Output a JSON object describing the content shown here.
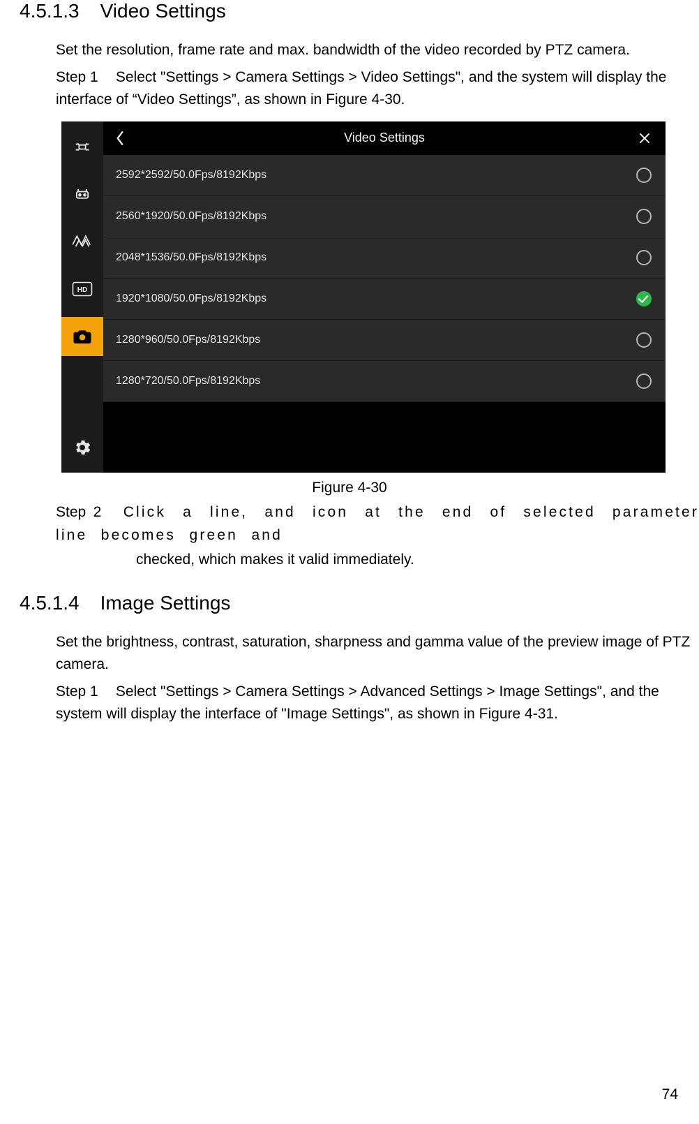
{
  "section1": {
    "number": "4.5.1.3",
    "title": "Video Settings",
    "intro": "Set the resolution, frame rate and max. bandwidth of the video recorded by PTZ camera.",
    "step1_label": "Step 1",
    "step1_text": "Select \"Settings > Camera Settings > Video Settings\", and the system will display the interface of “Video Settings”, as shown in Figure 4-30.",
    "figure_caption": "Figure 4-30",
    "step2_label": "Step 2",
    "step2_line1": "Click a line, and icon at the end of selected parameter line becomes green and",
    "step2_line2": "checked, which makes it valid immediately."
  },
  "section2": {
    "number": "4.5.1.4",
    "title": "Image Settings",
    "intro": "Set the brightness, contrast, saturation, sharpness and gamma value of the preview image of PTZ camera.",
    "step1_label": "Step 1",
    "step1_text": "Select \"Settings > Camera Settings > Advanced Settings > Image Settings\", and the system will display the interface of \"Image Settings\", as shown in Figure 4-31."
  },
  "screenshot": {
    "title": "Video Settings",
    "options": [
      {
        "label": "2592*2592/50.0Fps/8192Kbps",
        "selected": false
      },
      {
        "label": "2560*1920/50.0Fps/8192Kbps",
        "selected": false
      },
      {
        "label": "2048*1536/50.0Fps/8192Kbps",
        "selected": false
      },
      {
        "label": "1920*1080/50.0Fps/8192Kbps",
        "selected": true
      },
      {
        "label": "1280*960/50.0Fps/8192Kbps",
        "selected": false
      },
      {
        "label": "1280*720/50.0Fps/8192Kbps",
        "selected": false
      }
    ]
  },
  "page_number": "74"
}
